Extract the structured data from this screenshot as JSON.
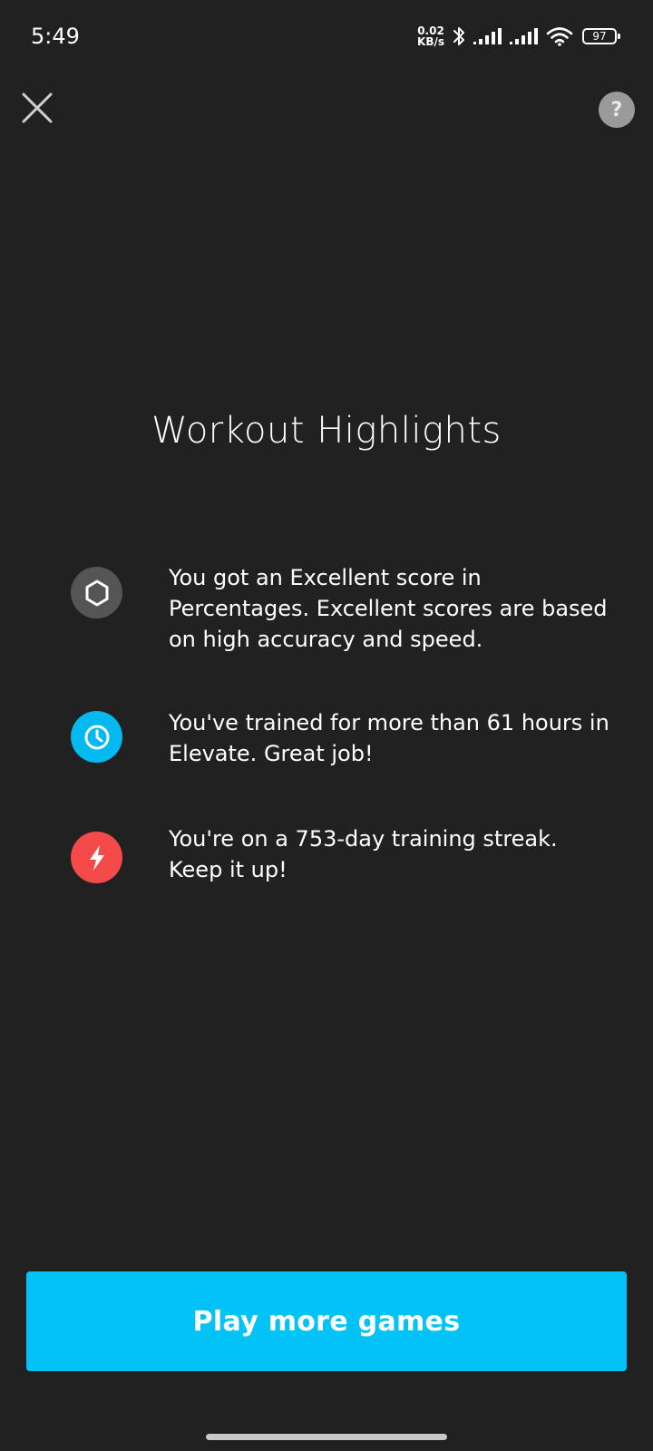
{
  "status_bar": {
    "time": "5:49",
    "net_speed_value": "0.02",
    "net_speed_unit": "KB/s",
    "battery_level": "97"
  },
  "header": {
    "close_icon": "close-icon",
    "help_label": "?"
  },
  "title": "Workout Highlights",
  "highlights": [
    {
      "icon": "hexagon-icon",
      "icon_bg": "#555555",
      "text": "You got an Excellent score in Percentages. Excellent scores are based on high accuracy and speed."
    },
    {
      "icon": "clock-icon",
      "icon_bg": "#03b9ef",
      "text": "You've trained for more than 61 hours in Elevate. Great job!"
    },
    {
      "icon": "lightning-icon",
      "icon_bg": "#f54a4a",
      "text": "You're on a 753-day training streak. Keep it up!"
    }
  ],
  "cta": {
    "label": "Play more games",
    "color": "#03c2f6"
  }
}
